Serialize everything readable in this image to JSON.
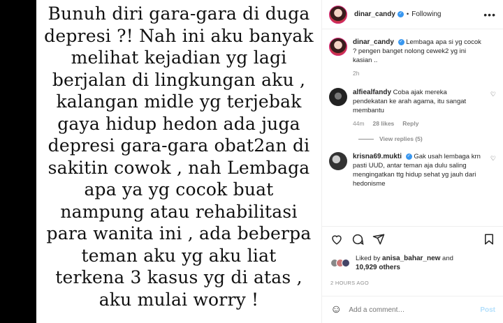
{
  "post_image": {
    "lines": [
      "Bunuh diri gara-gara di duga",
      "depresi ?! Nah ini aku banyak",
      "melihat kejadian yg lagi",
      "berjalan di lingkungan aku ,",
      "kalangan midle yg terjebak",
      "gaya hidup hedon ada juga",
      "depresi gara-gara obat2an di",
      "sakitin cowok , nah Lembaga",
      "apa ya yg cocok buat",
      "nampung atau rehabilitasi",
      "para wanita ini , ada beberpa",
      "teman aku yg aku liat",
      "terkena 3 kasus yg di atas ,",
      "aku mulai worry !"
    ]
  },
  "header": {
    "username": "dinar_candy",
    "separator": "•",
    "follow_status": "Following",
    "more": "•••"
  },
  "caption": {
    "username": "dinar_candy",
    "text": "Lembaga apa si yg cocok ? pengen banget nolong cewek2 yg ini kasian ..",
    "time": "2h"
  },
  "comments": [
    {
      "username": "alfiealfandy",
      "text": "Coba ajak mereka pendekatan ke arah agama, itu sangat membantu",
      "time": "44m",
      "likes": "28 likes",
      "reply": "Reply"
    },
    {
      "username": "krisna69.mukti",
      "text": "Gak usah lembaga krn pasti UUD, antar teman aja dulu saling mengingatkan ttg hidup sehat yg jauh dari hedonisme"
    }
  ],
  "view_replies": "View replies (5)",
  "likes": {
    "prefix": "Liked by",
    "user": "anisa_bahar_new",
    "and": "and",
    "others": "10,929 others"
  },
  "timestamp": "2 HOURS AGO",
  "add_comment": {
    "placeholder": "Add a comment…",
    "post_label": "Post"
  }
}
